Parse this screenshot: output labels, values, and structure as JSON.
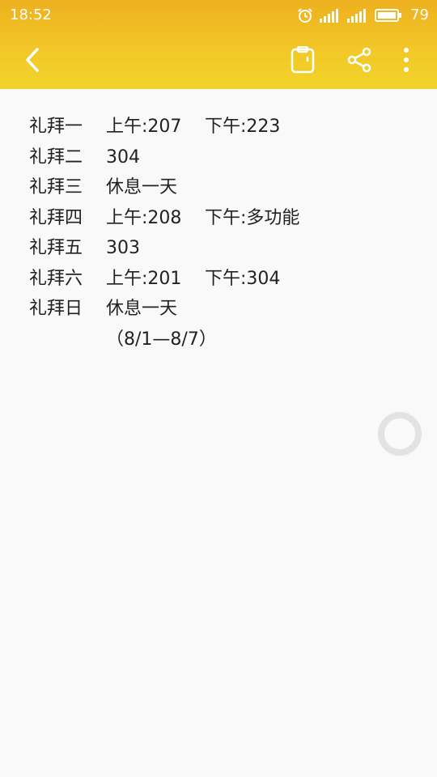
{
  "status_bar": {
    "time": "18:52",
    "battery": "79"
  },
  "toolbar": {
    "back_icon": "chevron-left-icon",
    "clip_icon": "clipboard-icon",
    "share_icon": "share-icon",
    "more_icon": "more-vertical-icon"
  },
  "schedule": [
    {
      "day": "礼拜一",
      "a": "上午:207",
      "b": "下午:223"
    },
    {
      "day": "礼拜二",
      "a": "304",
      "b": ""
    },
    {
      "day": "礼拜三",
      "a": "休息一天",
      "b": ""
    },
    {
      "day": "礼拜四",
      "a": "上午:208",
      "b": "下午:多功能"
    },
    {
      "day": "礼拜五",
      "a": "303",
      "b": ""
    },
    {
      "day": "礼拜六",
      "a": "上午:201",
      "b": "下午:304"
    },
    {
      "day": "礼拜日",
      "a": "休息一天",
      "b": ""
    }
  ],
  "note": "（8/1—8/7）",
  "colors": {
    "accent": "#f0c024",
    "text": "#222222",
    "background": "#f9f9f9"
  }
}
